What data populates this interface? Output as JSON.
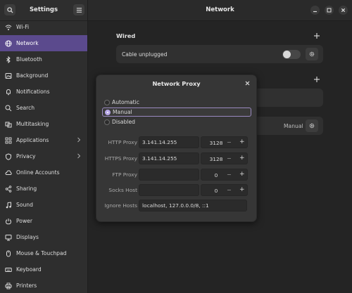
{
  "sidebar": {
    "title": "Settings",
    "items": [
      {
        "label": "Wi-Fi",
        "icon": "wifi-icon"
      },
      {
        "label": "Network",
        "icon": "network-icon",
        "active": true
      },
      {
        "label": "Bluetooth",
        "icon": "bluetooth-icon"
      },
      {
        "label": "Background",
        "icon": "background-icon"
      },
      {
        "label": "Notifications",
        "icon": "bell-icon"
      },
      {
        "label": "Search",
        "icon": "search-icon"
      },
      {
        "label": "Multitasking",
        "icon": "multitasking-icon"
      },
      {
        "label": "Applications",
        "icon": "applications-icon",
        "chevron": true
      },
      {
        "label": "Privacy",
        "icon": "privacy-icon",
        "chevron": true
      },
      {
        "label": "Online Accounts",
        "icon": "online-accounts-icon"
      },
      {
        "label": "Sharing",
        "icon": "sharing-icon"
      },
      {
        "label": "Sound",
        "icon": "sound-icon"
      },
      {
        "label": "Power",
        "icon": "power-icon"
      },
      {
        "label": "Displays",
        "icon": "displays-icon"
      },
      {
        "label": "Mouse & Touchpad",
        "icon": "mouse-icon"
      },
      {
        "label": "Keyboard",
        "icon": "keyboard-icon"
      },
      {
        "label": "Printers",
        "icon": "printer-icon"
      }
    ]
  },
  "header": {
    "title": "Network"
  },
  "wired": {
    "title": "Wired",
    "status": "Cable unplugged"
  },
  "proxy_row": {
    "value": "Manual"
  },
  "dialog": {
    "title": "Network Proxy",
    "modes": [
      {
        "label": "Automatic",
        "selected": false
      },
      {
        "label": "Manual",
        "selected": true
      },
      {
        "label": "Disabled",
        "selected": false
      }
    ],
    "fields": [
      {
        "label": "HTTP Proxy",
        "host": "3.141.14.255",
        "port": "3128"
      },
      {
        "label": "HTTPS Proxy",
        "host": "3.141.14.255",
        "port": "3128"
      },
      {
        "label": "FTP Proxy",
        "host": "",
        "port": "0"
      },
      {
        "label": "Socks Host",
        "host": "",
        "port": "0"
      }
    ],
    "ignore": {
      "label": "Ignore Hosts",
      "value": "localhost, 127.0.0.0/8, ::1"
    }
  },
  "colors": {
    "accent": "#5b4a8d",
    "radio_on": "#b8a8e8"
  }
}
